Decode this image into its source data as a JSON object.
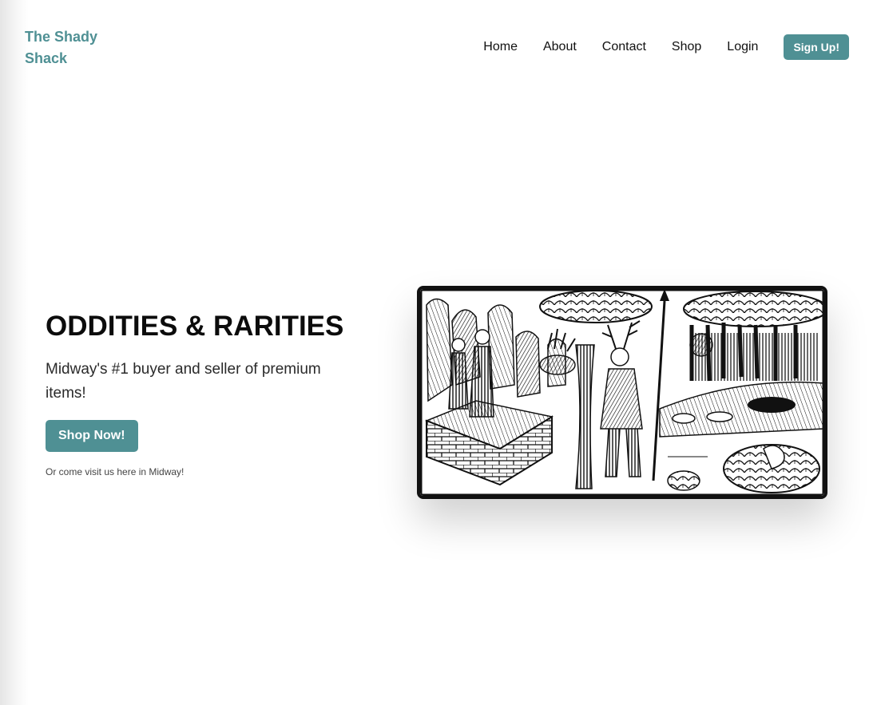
{
  "brand": {
    "name": "The Shady Shack"
  },
  "nav": {
    "items": [
      "Home",
      "About",
      "Contact",
      "Shop",
      "Login"
    ],
    "signup_label": "Sign Up!"
  },
  "hero": {
    "title": "ODDITIES & RARITIES",
    "subtitle": "Midway's #1 buyer and seller of premium items!",
    "cta_label": "Shop Now!",
    "note": "Or come visit us here in Midway!",
    "image_icon": "woodcut-illustration"
  },
  "colors": {
    "accent": "#4f9094",
    "text": "#111111",
    "background": "#ffffff"
  }
}
